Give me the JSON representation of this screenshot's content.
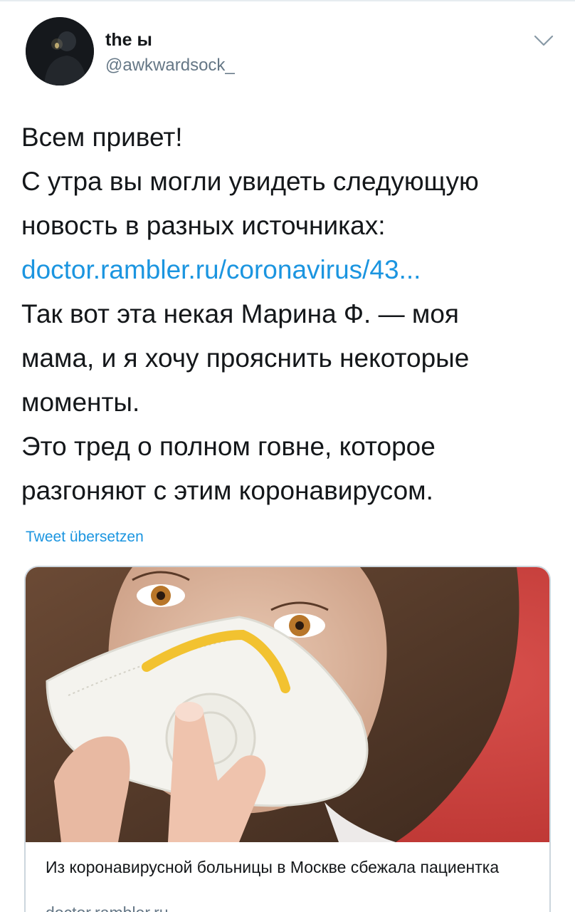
{
  "user": {
    "display_name": "the ы",
    "handle": "@awkwardsock_"
  },
  "tweet": {
    "lines": [
      "Всем привет!",
      "С утра вы могли увидеть следующую",
      "новость в разных источниках:"
    ],
    "link": "doctor.rambler.ru/coronavirus/43...",
    "lines_after": [
      "Так вот эта некая Марина Ф. — моя",
      "мама, и я хочу прояснить некоторые",
      "моменты.",
      "Это тред о полном говне, которое",
      "разгоняют с этим коронавирусом."
    ],
    "translate_label": "Tweet übersetzen"
  },
  "card": {
    "title": "Из коронавирусной больницы в Москве сбежала пациентка",
    "domain": "doctor.rambler.ru"
  },
  "icons": {
    "menu": "chevron-down-icon",
    "avatar": "avatar-photo"
  },
  "colors": {
    "link": "#1b95e0",
    "text": "#14171a",
    "secondary": "#657786",
    "border": "#ccd6dd",
    "image_background": "#c9403f",
    "mask_strap": "#f2c230"
  }
}
